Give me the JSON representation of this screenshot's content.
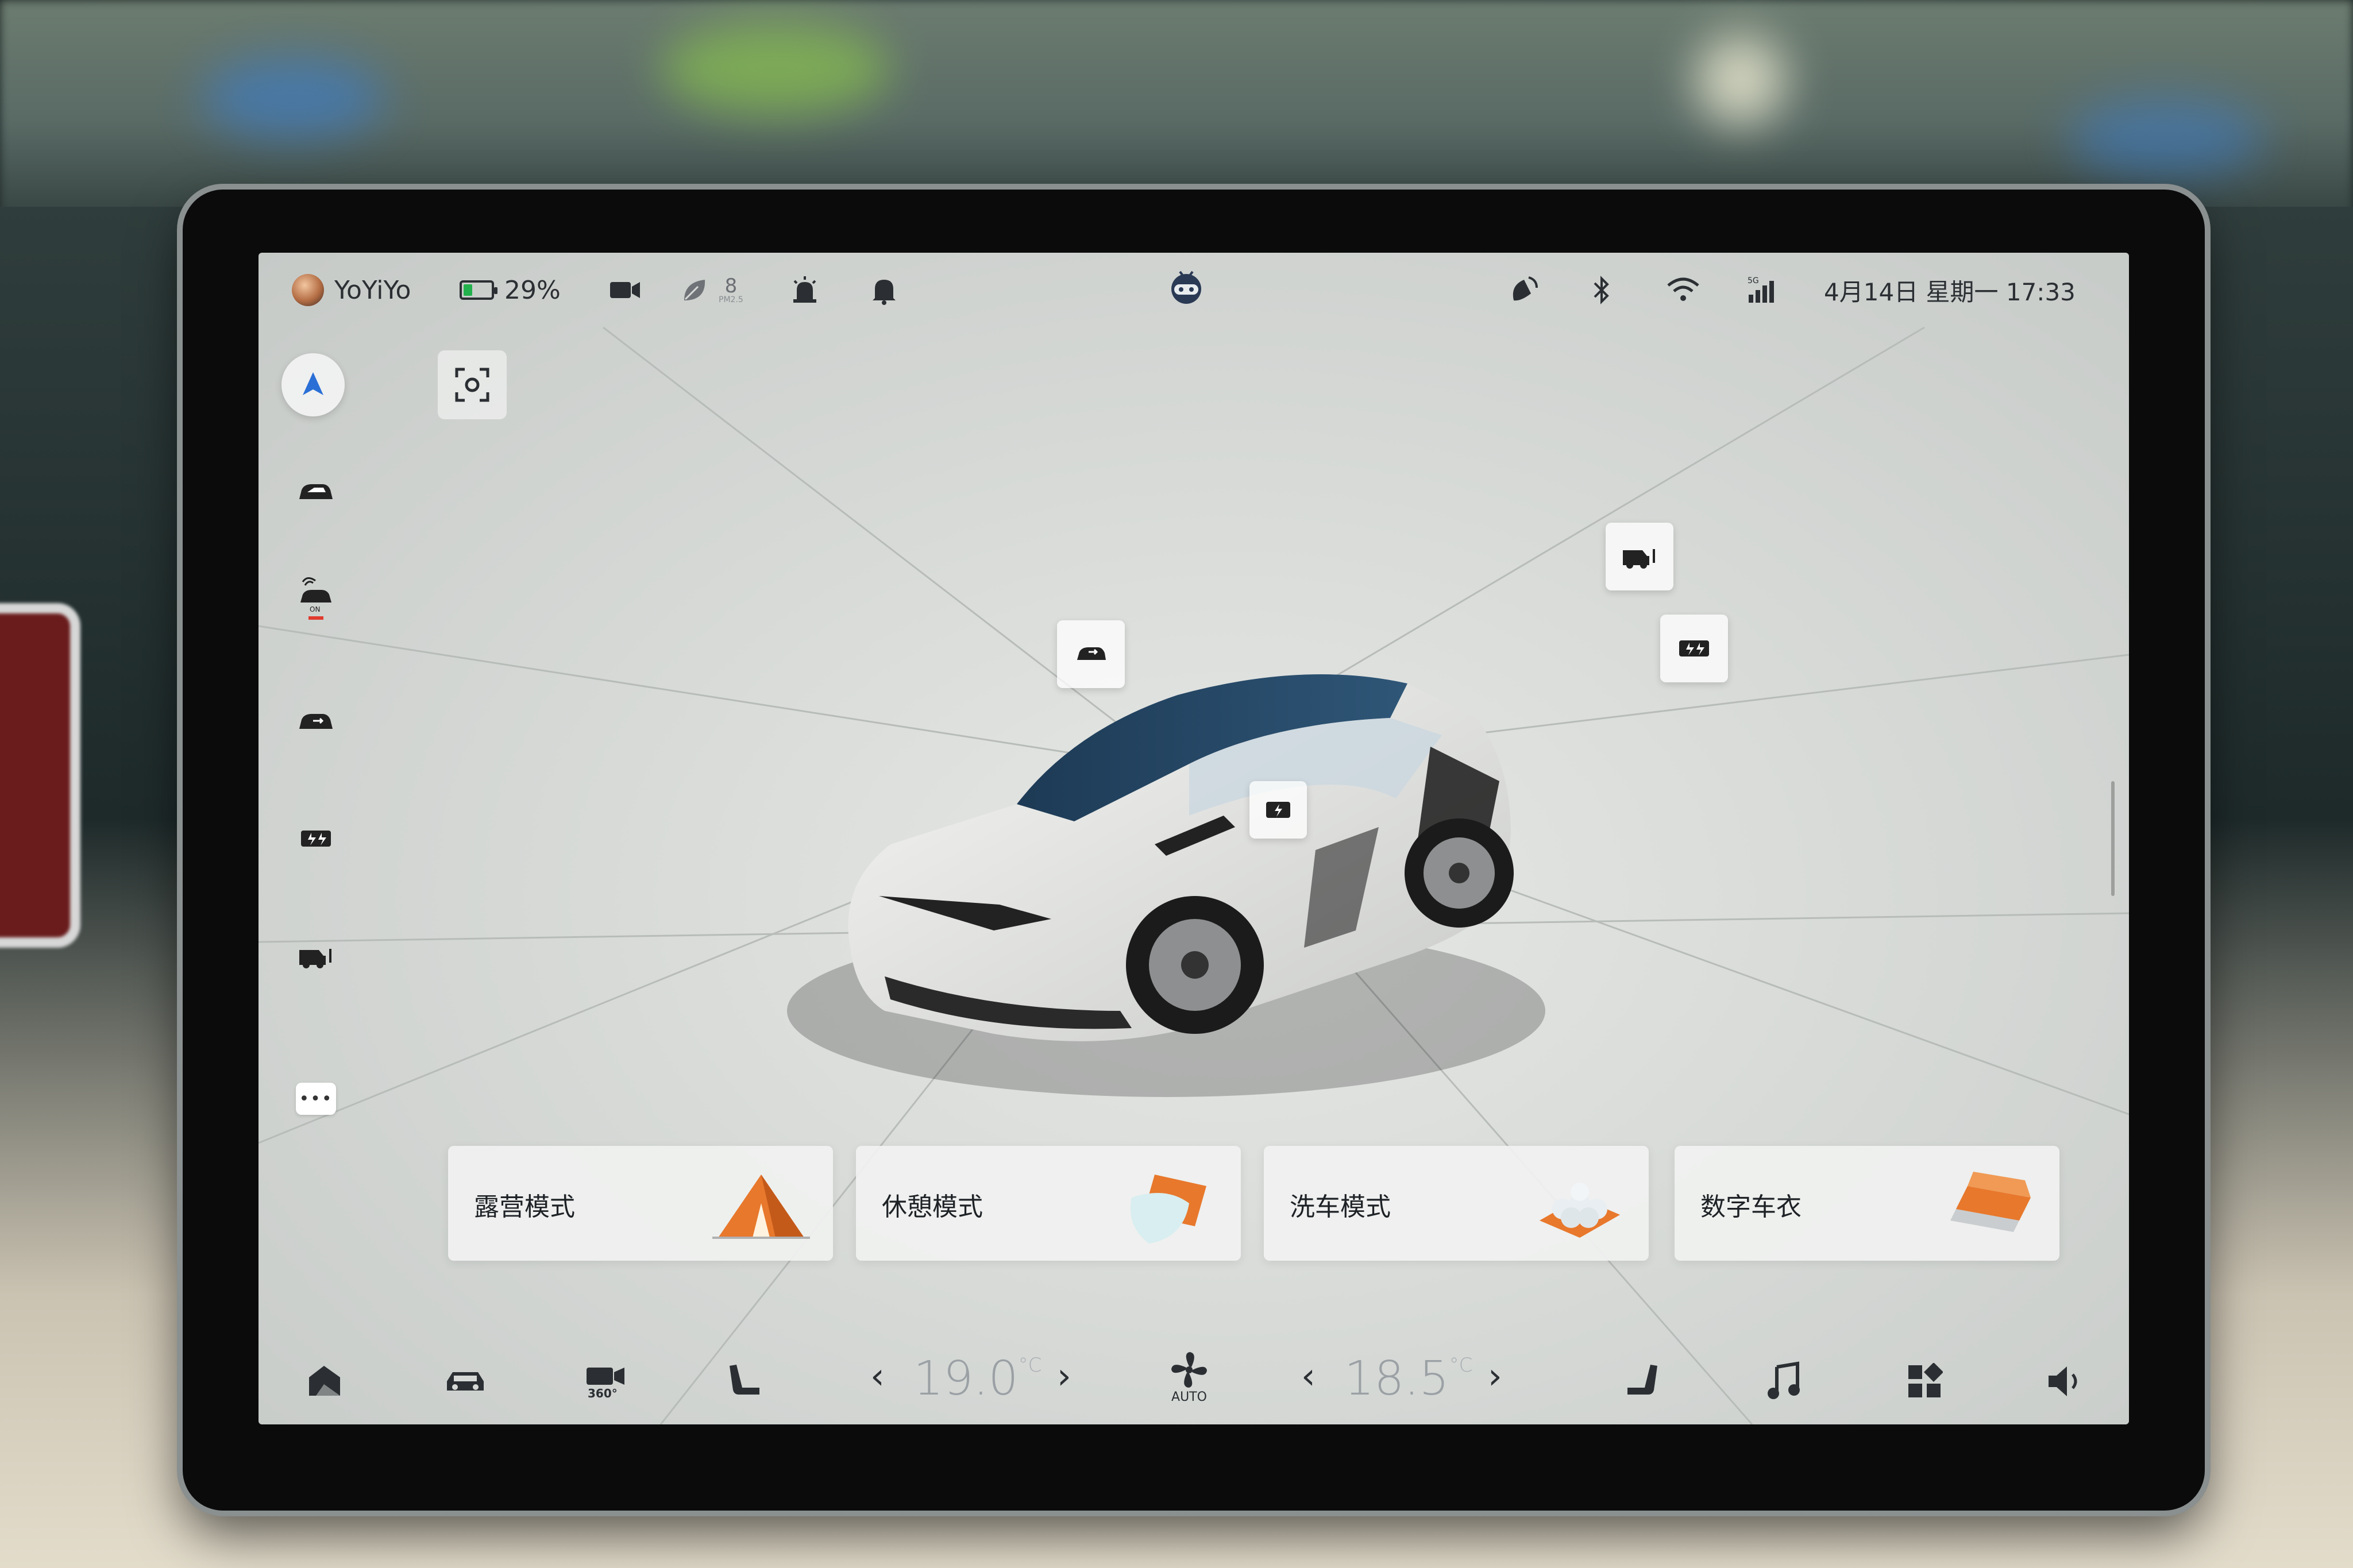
{
  "status_bar": {
    "user_name": "YoYiYo",
    "battery_percent": "29%",
    "battery_level": 0.29,
    "pm_value": "8",
    "pm_unit": "PM2.5",
    "datetime": "4月14日 星期一 17:33",
    "signal_label": "5G"
  },
  "modes": [
    {
      "label": "露营模式",
      "icon": "tent"
    },
    {
      "label": "休憩模式",
      "icon": "pillow"
    },
    {
      "label": "洗车模式",
      "icon": "car-wash-foam"
    },
    {
      "label": "数字车衣",
      "icon": "paint-layers"
    }
  ],
  "climate": {
    "left_temp": "19.0",
    "right_temp": "18.5",
    "unit": "°C",
    "fan_mode": "AUTO"
  },
  "dock_icons": [
    "home-icon",
    "car-icon",
    "camera-360-icon",
    "seat-icon",
    "fan-icon",
    "seat-icon",
    "music-icon",
    "apps-icon",
    "volume-icon"
  ],
  "colors": {
    "battery_green": "#22b14c",
    "nav_blue": "#2a6fd6",
    "warning_red": "#e03a2f",
    "card_bg": "#f0f1f0",
    "accent_orange": "#e8782c"
  },
  "camera_badge": "360°"
}
